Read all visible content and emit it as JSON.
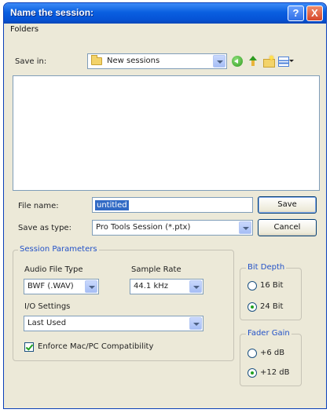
{
  "window": {
    "title": "Name the session:",
    "help_glyph": "?",
    "close_glyph": "X"
  },
  "menu": {
    "folders": "Folders"
  },
  "save_in": {
    "label": "Save in:",
    "value": "New sessions"
  },
  "toolbar_icons": [
    "back-icon",
    "up-folder-icon",
    "new-folder-icon",
    "views-menu-icon"
  ],
  "file_name": {
    "label": "File name:",
    "value": "untitled"
  },
  "save_as_type": {
    "label": "Save as type:",
    "value": "Pro Tools Session (*.ptx)"
  },
  "buttons": {
    "save": "Save",
    "cancel": "Cancel"
  },
  "session_parameters": {
    "title": "Session Parameters",
    "audio_file_type": {
      "label": "Audio File Type",
      "value": "BWF (.WAV)"
    },
    "sample_rate": {
      "label": "Sample Rate",
      "value": "44.1 kHz"
    },
    "io_settings": {
      "label": "I/O Settings",
      "value": "Last Used"
    },
    "enforce_compat": {
      "label": "Enforce Mac/PC Compatibility",
      "checked": true
    }
  },
  "bit_depth": {
    "title": "Bit Depth",
    "options": [
      {
        "label": "16 Bit",
        "selected": false
      },
      {
        "label": "24 Bit",
        "selected": true
      }
    ]
  },
  "fader_gain": {
    "title": "Fader Gain",
    "options": [
      {
        "label": "+6 dB",
        "selected": false
      },
      {
        "label": "+12 dB",
        "selected": true
      }
    ]
  },
  "colors": {
    "titlebar": "#0a5fe0",
    "dialog_bg": "#ece9d8",
    "group_title": "#2352c8",
    "radio_dot": "#21a121"
  }
}
